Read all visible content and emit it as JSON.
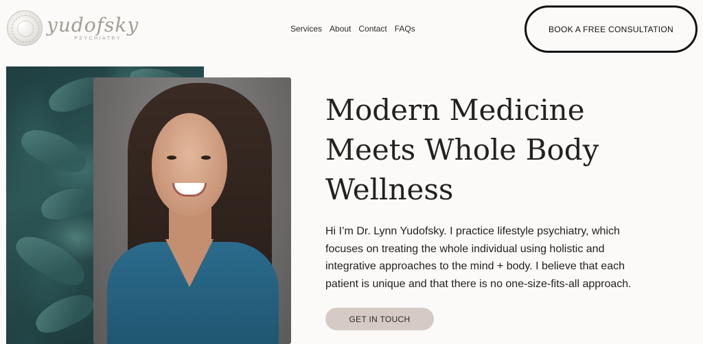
{
  "brand": {
    "name": "yudofsky",
    "sub": "PSYCHIATRY",
    "logo_icon": "circular-watercolor-logo"
  },
  "nav": {
    "items": [
      "Services",
      "About",
      "Contact",
      "FAQs"
    ]
  },
  "header_cta": "BOOK A FREE CONSULTATION",
  "hero": {
    "title_lines": [
      "Modern Medicine",
      "Meets Whole Body",
      "Wellness"
    ],
    "body_lines": [
      "Hi I’m Dr. Lynn Yudofsky. I practice lifestyle psychiatry, which",
      "focuses on treating the whole individual using holistic and",
      "integrative approaches to the mind + body. I believe that each",
      "patient is unique and that there is no one-size-fits-all approach."
    ],
    "cta": "GET IN TOUCH"
  },
  "colors": {
    "background": "#fbfaf8",
    "text": "#23211f",
    "cta_pill": "#d6cbc4",
    "logo": "#a29d95",
    "agave": "#2d5656"
  }
}
